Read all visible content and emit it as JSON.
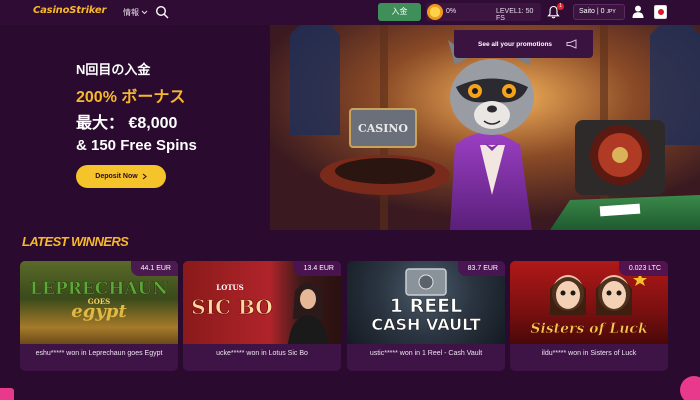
{
  "header": {
    "logo": "CasinoStriker",
    "info_menu": "情報",
    "deposit_label": "入金",
    "level": {
      "percent": "0%",
      "label": "LEVEL1: 50 FS",
      "progress": 0
    },
    "notification_count": "1",
    "balance": "Saito | 0 ",
    "balance_currency": "JPY"
  },
  "promotions": {
    "label": "See all your promotions"
  },
  "hero": {
    "line1": "N回目の入金",
    "line2": "200% ボーナス",
    "line3": "最大： €8,000",
    "line4": "& 150 Free Spins",
    "cta": "Deposit Now"
  },
  "winners": {
    "title": "LATEST WINNERS",
    "cards": [
      {
        "amount": "44.1 EUR",
        "game_art": "LEPRECHAUN",
        "game_art_sub": "GOES",
        "game_art_line2": "egypt",
        "caption": "eshu***** won in Leprechaun goes Egypt"
      },
      {
        "amount": "13.4 EUR",
        "game_art": "SIC BO",
        "game_art_sub": "LOTUS",
        "caption": "ucke***** won in Lotus Sic Bo"
      },
      {
        "amount": "83.7 EUR",
        "game_art": "1 REEL",
        "game_art_line2": "CASH VAULT",
        "caption": "ustic***** won in 1 Reel - Cash Vault"
      },
      {
        "amount": "0.023 LTC",
        "game_art": "Sisters of Luck",
        "caption": "ildu***** won in Sisters of Luck"
      }
    ]
  },
  "colors": {
    "accent": "#f7b82a",
    "background": "#2a0a2e",
    "deposit_green": "#3f8f5a",
    "card_bg": "#3e1446"
  }
}
